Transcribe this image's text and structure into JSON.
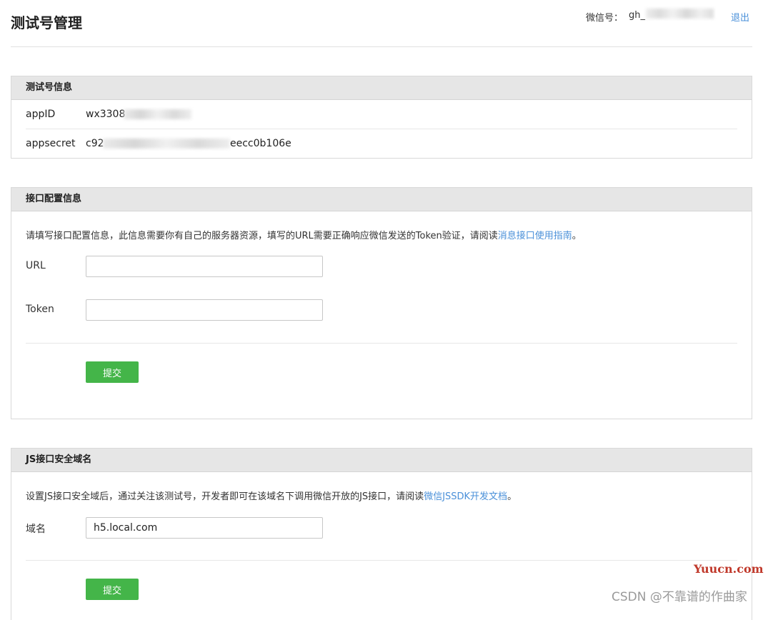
{
  "header": {
    "title": "测试号管理",
    "wechat_label": "微信号：",
    "wechat_value": "gh_",
    "logout": "退出"
  },
  "test_account": {
    "title": "测试号信息",
    "rows": [
      {
        "key": "appID",
        "value": "wx3308"
      },
      {
        "key": "appsecret",
        "value": "c92",
        "value_tail": "eecc0b106e"
      }
    ]
  },
  "interface_config": {
    "title": "接口配置信息",
    "description_prefix": "请填写接口配置信息，此信息需要你有自己的服务器资源，填写的URL需要正确响应微信发送的Token验证，请阅读",
    "description_link": "消息接口使用指南",
    "description_suffix": "。",
    "url_label": "URL",
    "url_value": "",
    "token_label": "Token",
    "token_value": "",
    "submit_label": "提交"
  },
  "js_domain": {
    "title": "JS接口安全域名",
    "description_prefix": "设置JS接口安全域后，通过关注该测试号，开发者即可在该域名下调用微信开放的JS接口，请阅读",
    "description_link": "微信JSSDK开发文档",
    "description_suffix": "。",
    "domain_label": "域名",
    "domain_value": "h5.local.com",
    "submit_label": "提交"
  },
  "watermarks": {
    "site": "Yuucn.com",
    "csdn": "CSDN @不靠谱的作曲家"
  }
}
